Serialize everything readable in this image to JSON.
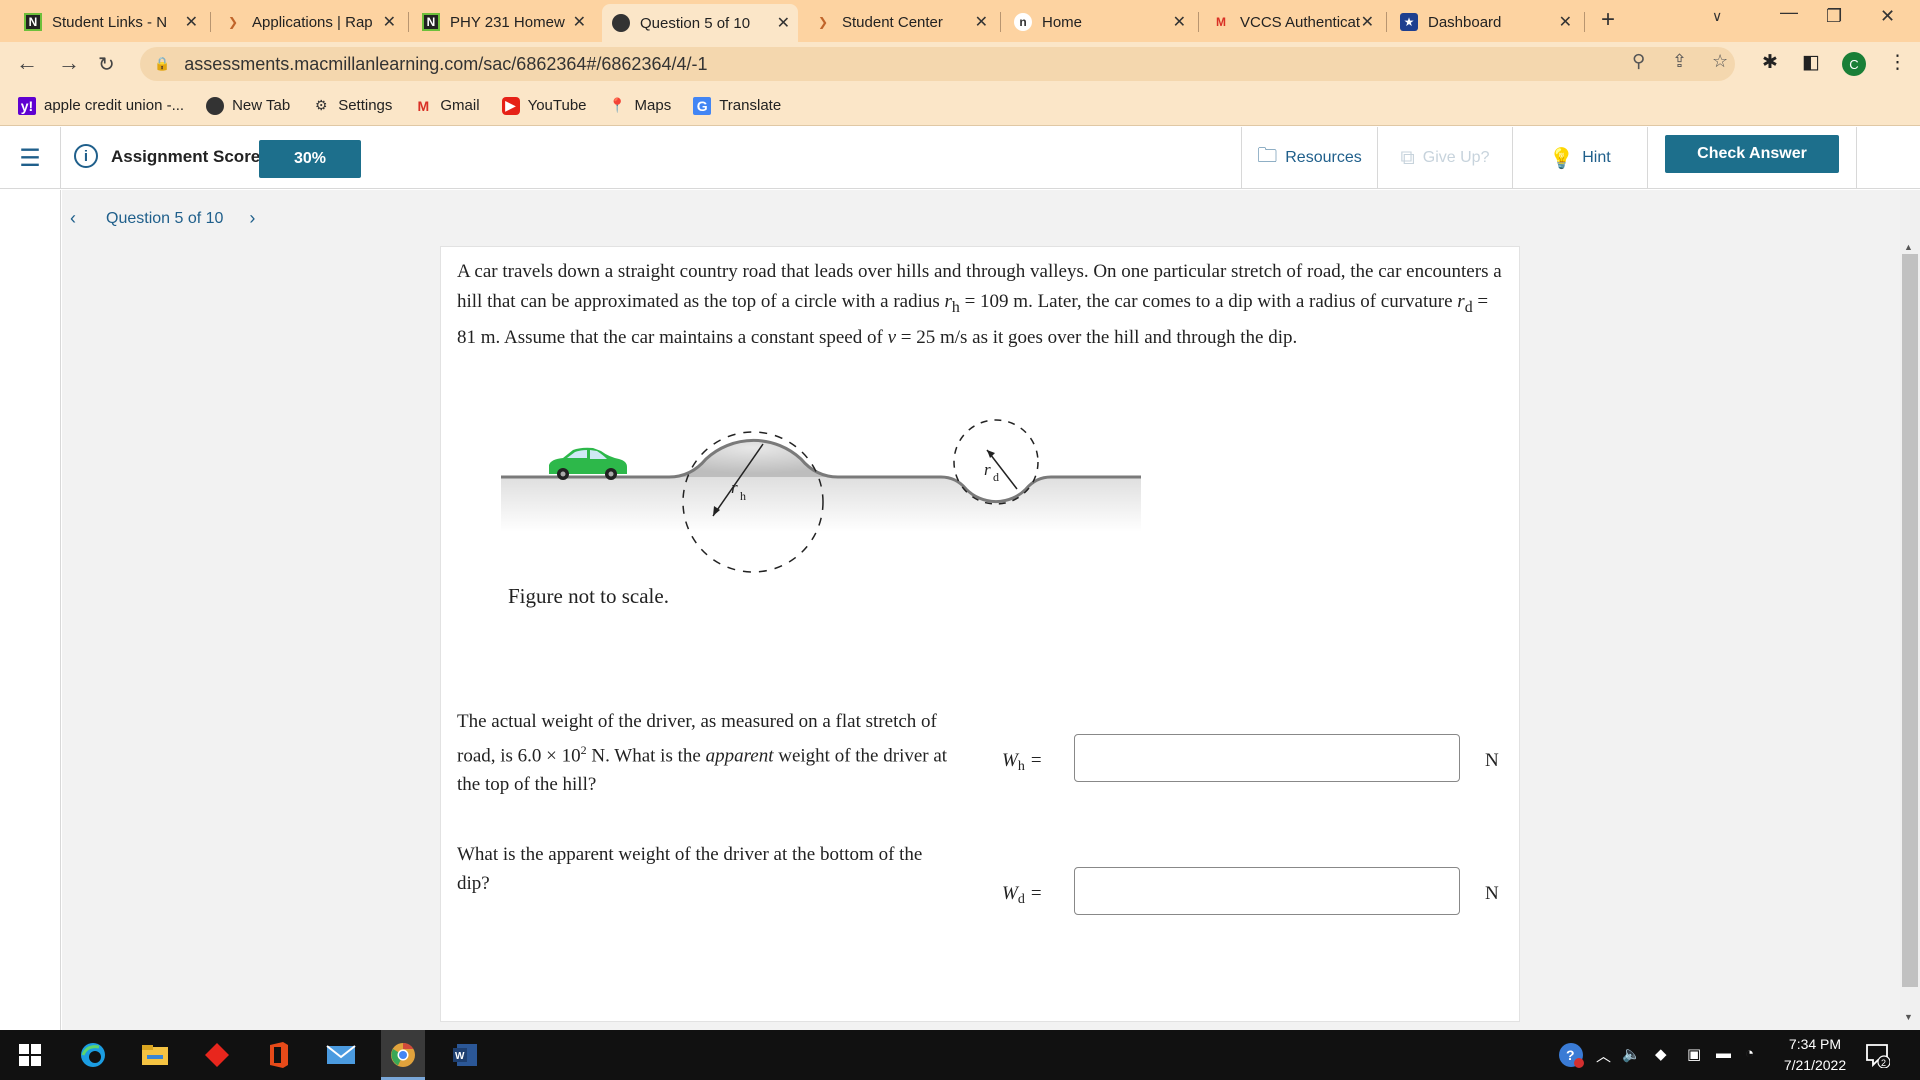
{
  "browser": {
    "tabs": [
      {
        "title": "Student Links - N",
        "icon": "n-logo-icon"
      },
      {
        "title": "Applications | Rap",
        "icon": "macmillan-icon"
      },
      {
        "title": "PHY 231 Homew",
        "icon": "n-logo-icon"
      },
      {
        "title": "Question 5 of 10",
        "icon": "globe-icon",
        "active": true
      },
      {
        "title": "Student Center",
        "icon": "macmillan-icon"
      },
      {
        "title": "Home",
        "icon": "n-circle-icon"
      },
      {
        "title": "VCCS Authenticat",
        "icon": "gmail-icon"
      },
      {
        "title": "Dashboard",
        "icon": "star-icon"
      }
    ],
    "url": "assessments.macmillanlearning.com/sac/6862364#/6862364/4/-1",
    "profile_initial": "C",
    "bookmarks": [
      {
        "label": "apple credit union -...",
        "icon": "yahoo-icon"
      },
      {
        "label": "New Tab",
        "icon": "globe-icon"
      },
      {
        "label": "Settings",
        "icon": "gear-icon"
      },
      {
        "label": "Gmail",
        "icon": "gmail-icon"
      },
      {
        "label": "YouTube",
        "icon": "youtube-icon"
      },
      {
        "label": "Maps",
        "icon": "maps-icon"
      },
      {
        "label": "Translate",
        "icon": "translate-icon"
      }
    ]
  },
  "header": {
    "score_label": "Assignment Score:",
    "score_value": "30%",
    "resources_label": "Resources",
    "giveup_label": "Give Up?",
    "hint_label": "Hint",
    "check_label": "Check Answer"
  },
  "nav": {
    "question_label": "Question 5 of 10"
  },
  "problem": {
    "p1": "A car travels down a straight country road that leads over hills and through valleys. On one particular stretch of road, the car encounters a hill that can be approximated as the top of a circle with a radius ",
    "rh_sym": "r",
    "rh_sub": "h",
    "p2": " = 109 m. Later, the car comes to a dip with a radius of curvature ",
    "rd_sym": "r",
    "rd_sub": "d",
    "p3": " = 81 m. Assume that the car maintains a constant speed of ",
    "v_sym": "v",
    "p4": " = 25 m/s as it goes over the hill and through the dip.",
    "caption": "Figure not to scale.",
    "fig_rh": "r",
    "fig_rh_sub": "h",
    "fig_rd": "r",
    "fig_rd_sub": "d"
  },
  "questions": [
    {
      "text_a": "The actual weight of the driver, as measured on a flat stretch of road, is 6.0 × 10",
      "sup": "2",
      "text_b": " N. What is the ",
      "italic": "apparent",
      "text_c": " weight of the driver at the top of the hill?",
      "var": "W",
      "var_sub": "h",
      "eq": "=",
      "value": "",
      "unit": "N"
    },
    {
      "text": "What is the apparent weight of the driver at the bottom of the dip?",
      "var": "W",
      "var_sub": "d",
      "eq": "=",
      "value": "",
      "unit": "N"
    }
  ],
  "taskbar": {
    "time": "7:34 PM",
    "date": "7/21/2022",
    "notification_count": "2"
  },
  "colors": {
    "accent": "#1d6f8c",
    "tab_strip": "#fdd3a1",
    "toolbar": "#fbe6c8",
    "car": "#2db84a"
  }
}
